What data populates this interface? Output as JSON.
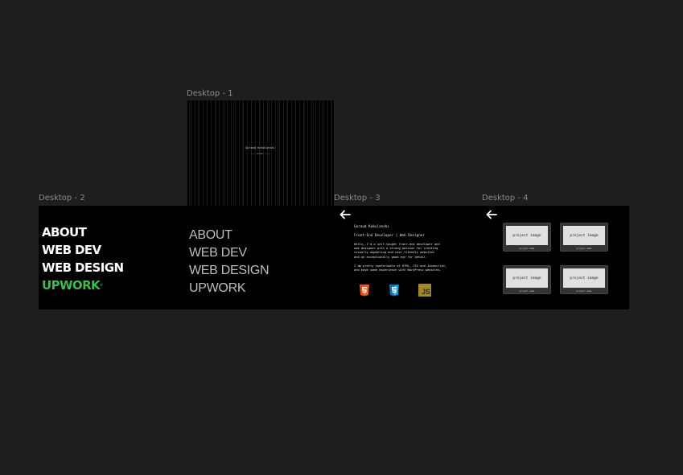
{
  "frames": {
    "desktop1": {
      "label": "Desktop - 1",
      "heading": "Goraud Kokolanski",
      "sub": "——— enter ———"
    },
    "desktop2": {
      "label": "Desktop - 2",
      "menu_bold": [
        "ABOUT",
        "WEB DEV",
        "WEB DESIGN",
        "UPWORK"
      ],
      "upwork_mark": "®",
      "menu_light": [
        "ABOUT",
        "WEB DEV",
        "WEB DESIGN",
        "UPWORK"
      ]
    },
    "desktop3": {
      "label": "Desktop - 3",
      "back_icon": "arrow-left-icon",
      "name": "Goraud Kokolanski",
      "role": "Front-End Developer | Web Designer",
      "paragraph1": [
        "Hello, I'm a self-taught front-end developer and",
        "web designer with a strong passion for creating",
        "visually appealing and user-friendly websites",
        "and an exceptionally good eye for detail."
      ],
      "paragraph2": [
        "I am pretty comfortable at HTML, CSS and Javascript,",
        "and have some experience with WordPress websites."
      ],
      "tech_icons": [
        "html5-icon",
        "css3-icon",
        "javascript-icon"
      ],
      "js_label": "JS"
    },
    "desktop4": {
      "label": "Desktop - 4",
      "back_icon": "arrow-left-icon",
      "projects": [
        {
          "image_label": "project image",
          "caption": "project name"
        },
        {
          "image_label": "project image",
          "caption": "project name"
        },
        {
          "image_label": "project image",
          "caption": "project name"
        },
        {
          "image_label": "project image",
          "caption": "project name"
        }
      ]
    }
  },
  "colors": {
    "canvas": "#1e1e1e",
    "frame": "#000000",
    "accent_green": "#3dbb4e",
    "label_gray": "#8a8a8a"
  }
}
